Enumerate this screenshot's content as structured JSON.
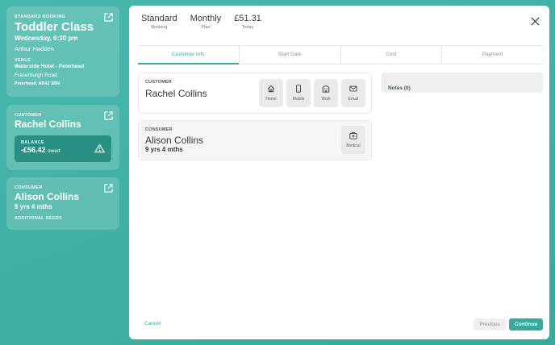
{
  "booking": {
    "label": "STANDARD BOOKING",
    "title": "Toddler Class",
    "datetime": "Wednesday, 6:30 pm",
    "instructor": "Arthur Hadden",
    "venue_label": "VENUE",
    "venue_name": "Waterside Hotel - Peterhead",
    "venue_street": "Fraserburgh Road",
    "venue_postcode": "Peterhead, AB42 3BN",
    "open_icon": "external-link-icon"
  },
  "customer": {
    "label": "CUSTOMER",
    "name": "Rachel Collins",
    "balance_label": "BALANCE",
    "balance_amount": "-£56.42",
    "balance_suffix": "owed",
    "warning_icon": "warning-icon"
  },
  "consumer": {
    "label": "CONSUMER",
    "name": "Alison Collins",
    "age": "9 yrs 4 mths",
    "needs_label": "ADDITIONAL NEEDS"
  },
  "summary": [
    {
      "value": "Standard",
      "key": "Booking"
    },
    {
      "value": "Monthly",
      "key": "Plan"
    },
    {
      "value": "£51.31",
      "key": "Today"
    }
  ],
  "tabs": [
    "Customer Info",
    "Start Date",
    "Cost",
    "Payment"
  ],
  "active_tab": "Customer Info",
  "customer_card": {
    "label": "CUSTOMER",
    "name": "Rachel Collins",
    "buttons": [
      {
        "label": "Home",
        "icon": "home-icon"
      },
      {
        "label": "Mobile",
        "icon": "mobile-icon"
      },
      {
        "label": "Work",
        "icon": "building-icon"
      },
      {
        "label": "Email",
        "icon": "mail-icon"
      }
    ]
  },
  "consumer_card": {
    "label": "CONSUMER",
    "name": "Alison Collins",
    "age": "9 yrs 4 mths",
    "buttons": [
      {
        "label": "Medical",
        "icon": "medical-kit-icon"
      }
    ]
  },
  "notes": {
    "label": "Notes (0)"
  },
  "footer": {
    "cancel": "Cancel",
    "previous": "Previous",
    "continue": "Continue"
  },
  "colors": {
    "accent": "#3aa99d",
    "sidebar_dark": "#2a8f85"
  }
}
